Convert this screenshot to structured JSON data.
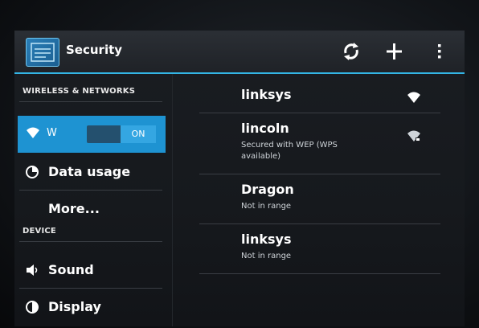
{
  "actionbar": {
    "title": "Security",
    "icons": [
      "settings-app-icon",
      "sync-icon",
      "add-icon",
      "overflow-menu-icon"
    ]
  },
  "left_nav": {
    "section_wireless": "WIRELESS & NETWORKS",
    "wifi": {
      "label": "W",
      "toggle_state": "ON"
    },
    "items": [
      {
        "label": "Data usage",
        "icon": "data-usage-icon"
      },
      {
        "label": "More..."
      }
    ],
    "section_device": "DEVICE",
    "device_items": [
      {
        "label": "Sound",
        "icon": "volume-icon"
      },
      {
        "label": "Display",
        "icon": "display-brightness-icon"
      }
    ]
  },
  "networks": [
    {
      "name": "linksys",
      "status": "",
      "signal_icon": "wifi-signal-icon"
    },
    {
      "name": "lincoln",
      "status": "Secured with WEP (WPS available)",
      "signal_icon": "wifi-lock-signal-icon"
    },
    {
      "name": "Dragon",
      "status": "Not in range"
    },
    {
      "name": "linksys",
      "status": "Not in range"
    }
  ],
  "colors": {
    "accent": "#33b5e5",
    "selected_row": "#1e93d2",
    "text": "#ffffff",
    "background": "#16191d"
  }
}
